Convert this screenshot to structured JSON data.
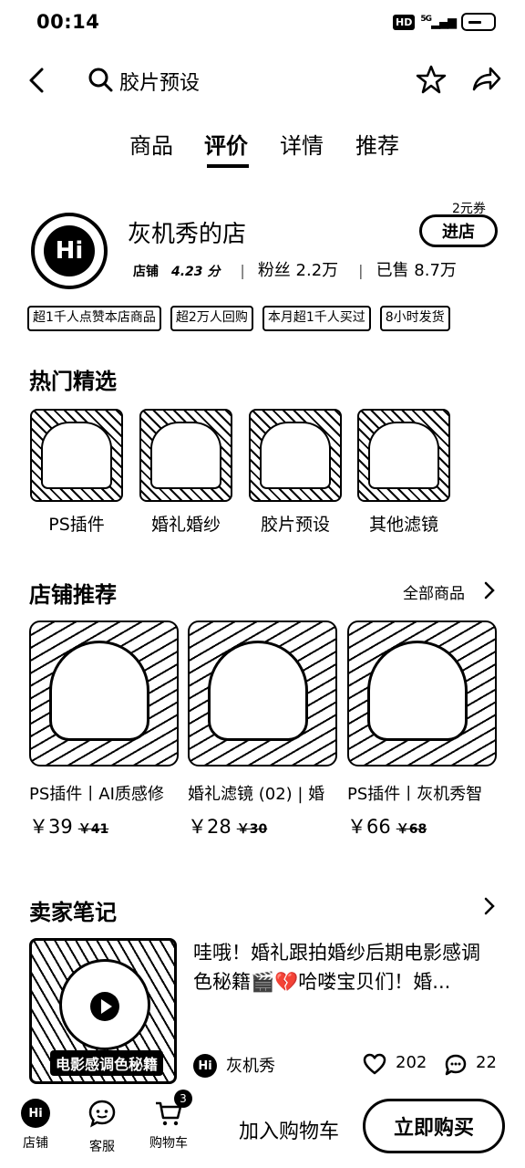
{
  "status_bar": {
    "time": "00:14",
    "hd": "HD",
    "network": "5G"
  },
  "header": {
    "search_text": "胶片预设"
  },
  "tabs": [
    {
      "label": "商品"
    },
    {
      "label": "评价"
    },
    {
      "label": "详情"
    },
    {
      "label": "推荐"
    }
  ],
  "active_tab": "评价",
  "shop": {
    "name": "灰机秀的店",
    "score_label": "店铺",
    "score": "4.23 分",
    "fans": "粉丝 2.2万",
    "sold": "已售 8.7万",
    "coupon": "2元券",
    "enter_label": "进店"
  },
  "tags": [
    "超1千人点赞本店商品",
    "超2万人回购",
    "本月超1千人买过",
    "8小时发货"
  ],
  "hot": {
    "title": "热门精选",
    "items": [
      {
        "label": "PS插件"
      },
      {
        "label": "婚礼婚纱"
      },
      {
        "label": "胶片预设"
      },
      {
        "label": "其他滤镜"
      }
    ]
  },
  "recommend": {
    "title": "店铺推荐",
    "more": "全部商品",
    "items": [
      {
        "title": "PS插件丨AI质感修",
        "price": "￥39",
        "old_price": "￥41"
      },
      {
        "title": "婚礼滤镜 (02) | 婚",
        "price": "￥28",
        "old_price": "￥30"
      },
      {
        "title": "PS插件丨灰机秀智",
        "price": "￥66",
        "old_price": "￥68"
      }
    ]
  },
  "note": {
    "title": "卖家笔记",
    "text": "哇哦！婚礼跟拍婚纱后期电影感调色秘籍🎬💔哈喽宝贝们！婚...",
    "image_caption": "电影感调色秘籍",
    "author": "灰机秀",
    "likes": "202",
    "comments": "22"
  },
  "bottom_bar": {
    "shop": "店铺",
    "service": "客服",
    "cart": "购物车",
    "cart_count": "3",
    "add_cart": "加入购物车",
    "buy_now": "立即购买"
  }
}
